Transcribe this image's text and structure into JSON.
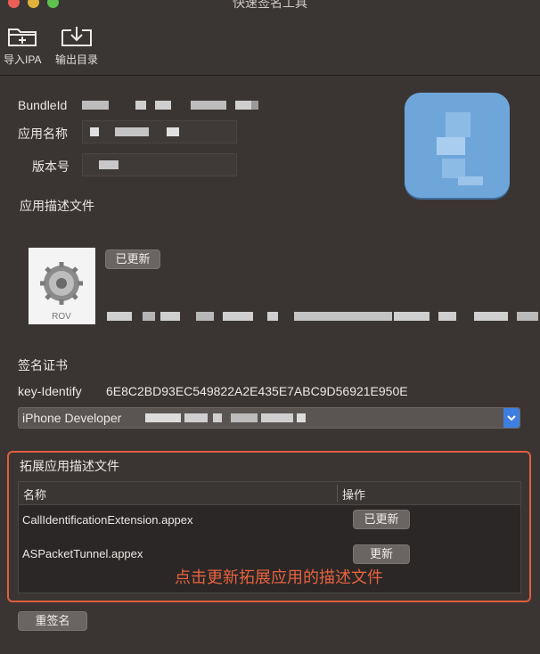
{
  "window": {
    "title": "快速签名工具"
  },
  "toolbar": {
    "import_label": "导入IPA",
    "output_label": "输出目录"
  },
  "app_info": {
    "bundle_id_label": "BundleId",
    "app_name_label": "应用名称",
    "version_label": "版本号",
    "profile_section_label": "应用描述文件",
    "profile_updated_button": "已更新",
    "profile_image_caption": "ROV"
  },
  "cert": {
    "section_label": "签名证书",
    "key_identify_label": "key-Identify",
    "key_identify_value": "6E8C2BD93EC549822A2E435E7ABC9D56921E950E",
    "selected_value": "iPhone Developer"
  },
  "extensions": {
    "section_label": "拓展应用描述文件",
    "columns": [
      "名称",
      "操作"
    ],
    "rows": [
      {
        "name": "CallIdentificationExtension.appex",
        "action": "已更新"
      },
      {
        "name": "ASPacketTunnel.appex",
        "action": "更新"
      }
    ],
    "annotation": "点击更新拓展应用的描述文件"
  },
  "footer": {
    "resign_button": "重签名"
  },
  "colors": {
    "window_bg": "#3a3533",
    "annotation": "#e8623f",
    "highlight_border": "#e05d3f",
    "select_accent": "#3e7ee0"
  }
}
